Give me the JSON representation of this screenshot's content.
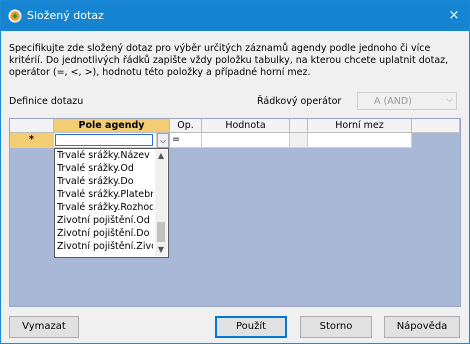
{
  "window": {
    "title": "Složený dotaz",
    "close_label": "×"
  },
  "description": "Specifikujte zde složený dotaz pro výběr určitých záznamů agendy podle jednoho či více kritérií. Do jednotlivých řádků zapište vždy položku tabulky, na kterou chcete uplatnit dotaz, operátor (=, <, >), hodnotu této položky a případné horní mez.",
  "labels": {
    "definice": "Definice dotazu",
    "operator": "Řádkový operátor"
  },
  "operator_select": {
    "value": "A (AND)"
  },
  "grid": {
    "columns": [
      "Pole agendy",
      "Op.",
      "Hodnota",
      "Horní mez"
    ],
    "row_indicator": "*",
    "current_op": "=",
    "dropdown_items": [
      "Trvalé srážky.Název",
      "Trvalé srážky.Od",
      "Trvalé srážky.Do",
      "Trvalé srážky.Platební",
      "Trvalé srážky.Rozhodnutí",
      "Životní pojištění.Od",
      "Životní pojištění.Do",
      "Životní pojištění.Živo"
    ]
  },
  "buttons": {
    "clear": "Vymazat",
    "apply": "Použít",
    "cancel": "Storno",
    "help": "Nápověda"
  },
  "colors": {
    "titlebar": "#1784d1",
    "header_active": "#f3cd73",
    "grid_bg": "#a9b8d6"
  }
}
